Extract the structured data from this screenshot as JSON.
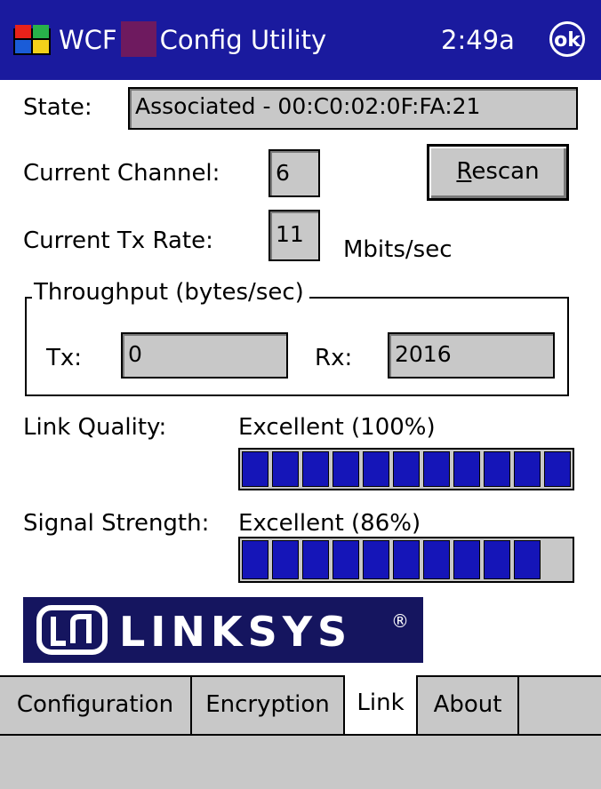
{
  "titlebar": {
    "app_name_prefix": "WCF",
    "app_name_suffix": "Config Utility",
    "time": "2:49a",
    "ok_label": "ok"
  },
  "state": {
    "label": "State:",
    "value": "Associated - 00:C0:02:0F:FA:21"
  },
  "channel": {
    "label": "Current Channel:",
    "value": "6"
  },
  "rescan_button": {
    "underlined_letter": "R",
    "rest": "escan"
  },
  "tx_rate": {
    "label": "Current Tx Rate:",
    "value": "11",
    "unit": "Mbits/sec"
  },
  "throughput": {
    "title": "Throughput (bytes/sec)",
    "tx_label": "Tx:",
    "tx_value": "0",
    "rx_label": "Rx:",
    "rx_value": "2016"
  },
  "link_quality": {
    "label": "Link Quality:",
    "text": "Excellent (100%)",
    "percent": 100,
    "segments_filled": 11,
    "segments_total": 11
  },
  "signal_strength": {
    "label": "Signal Strength:",
    "text": "Excellent (86%)",
    "percent": 86,
    "segments_filled": 10,
    "segments_total": 11
  },
  "logo": {
    "text": "LINKSYS",
    "mark": "®"
  },
  "tabs": [
    {
      "label": "Configuration",
      "active": false
    },
    {
      "label": "Encryption",
      "active": false
    },
    {
      "label": "Link",
      "active": true
    },
    {
      "label": "About",
      "active": false
    }
  ],
  "colors": {
    "titlebar": "#1a1a9e",
    "bar_fill": "#1515b8",
    "field_bg": "#c8c8c8",
    "logo_bg": "#15155f"
  }
}
